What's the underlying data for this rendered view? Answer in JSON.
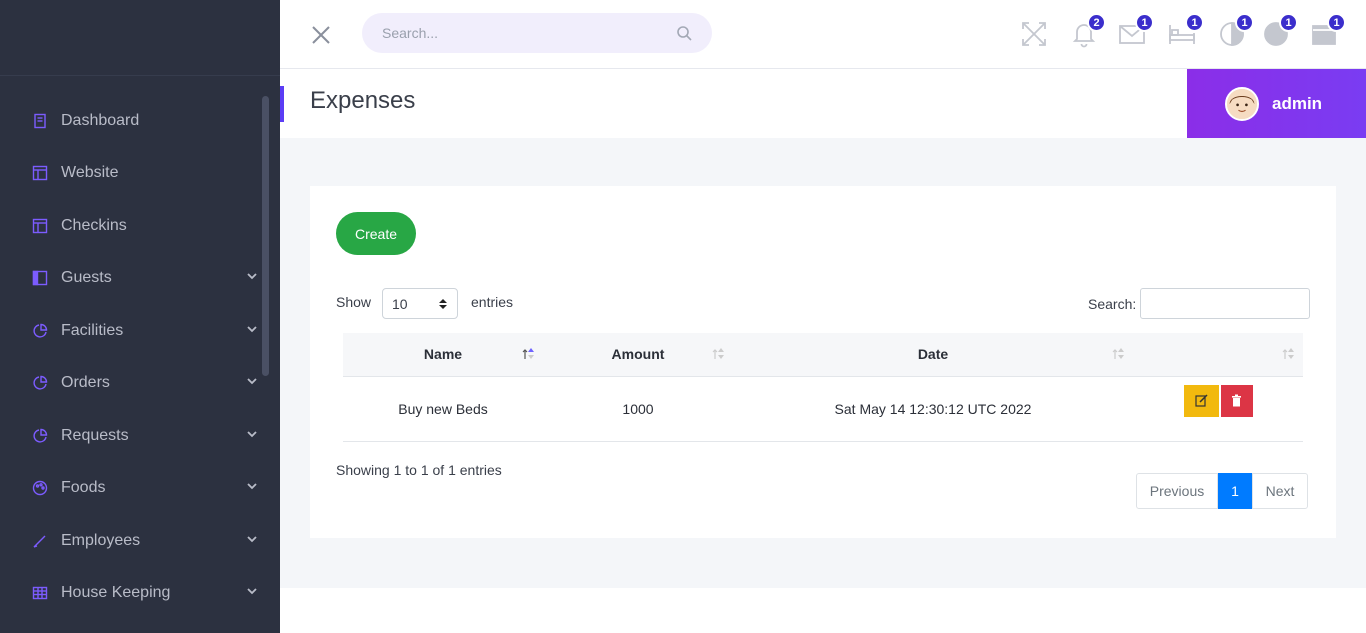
{
  "sidebar": {
    "items": [
      {
        "label": "Dashboard",
        "icon": "book-icon",
        "chevron": false
      },
      {
        "label": "Website",
        "icon": "layout-icon",
        "chevron": false
      },
      {
        "label": "Checkins",
        "icon": "layout-icon",
        "chevron": false
      },
      {
        "label": "Guests",
        "icon": "sidebar-icon",
        "chevron": true
      },
      {
        "label": "Facilities",
        "icon": "pie-chart-icon",
        "chevron": true
      },
      {
        "label": "Orders",
        "icon": "pie-chart-icon",
        "chevron": true
      },
      {
        "label": "Requests",
        "icon": "pie-chart-icon",
        "chevron": true
      },
      {
        "label": "Foods",
        "icon": "palette-icon",
        "chevron": true
      },
      {
        "label": "Employees",
        "icon": "pen-icon",
        "chevron": true
      },
      {
        "label": "House Keeping",
        "icon": "grid-icon",
        "chevron": true
      }
    ]
  },
  "topbar": {
    "search_placeholder": "Search...",
    "badges": {
      "notifications": "2",
      "messages": "1",
      "beds": "1",
      "chart": "1",
      "user": "1",
      "box": "1"
    }
  },
  "page": {
    "title": "Expenses",
    "user_name": "admin"
  },
  "card": {
    "create_label": "Create",
    "show_label": "Show",
    "page_length": "10",
    "entries_label": "entries",
    "search_label": "Search:",
    "columns": [
      "Name",
      "Amount",
      "Date",
      ""
    ],
    "rows": [
      {
        "name": "Buy new Beds",
        "amount": "1000",
        "date": "Sat May 14 12:30:12 UTC 2022"
      }
    ],
    "info": "Showing 1 to 1 of 1 entries",
    "pager": {
      "prev": "Previous",
      "current": "1",
      "next": "Next"
    }
  },
  "colors": {
    "sidebar_bg": "#2c3140",
    "accent": "#7c5cff",
    "create": "#28a745",
    "edit": "#f2b90e",
    "delete": "#dc3545",
    "page_active": "#007bff"
  }
}
